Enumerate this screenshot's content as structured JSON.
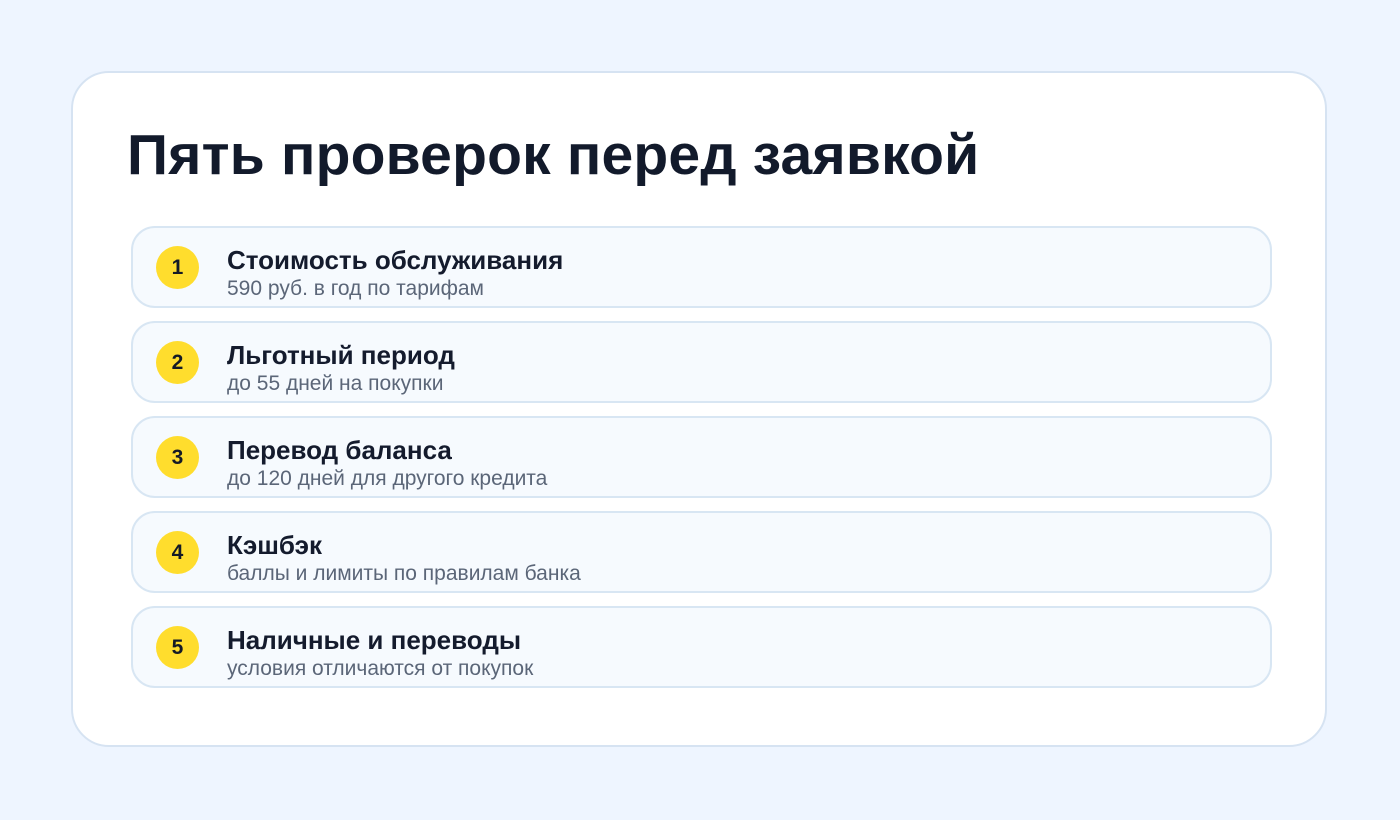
{
  "page": {
    "title": "Пять проверок перед заявкой"
  },
  "colors": {
    "background": "#eef5ff",
    "card": "#ffffff",
    "badge": "#ffdd2d",
    "title_text": "#121a2b",
    "subtitle_text": "#5b6678"
  },
  "checks": [
    {
      "number": "1",
      "title": "Стоимость обслуживания",
      "subtitle": "590 руб. в год по тарифам"
    },
    {
      "number": "2",
      "title": "Льготный период",
      "subtitle": "до 55 дней на покупки"
    },
    {
      "number": "3",
      "title": "Перевод баланса",
      "subtitle": "до 120 дней для другого кредита"
    },
    {
      "number": "4",
      "title": "Кэшбэк",
      "subtitle": "баллы и лимиты по правилам банка"
    },
    {
      "number": "5",
      "title": "Наличные и переводы",
      "subtitle": "условия отличаются от покупок"
    }
  ]
}
